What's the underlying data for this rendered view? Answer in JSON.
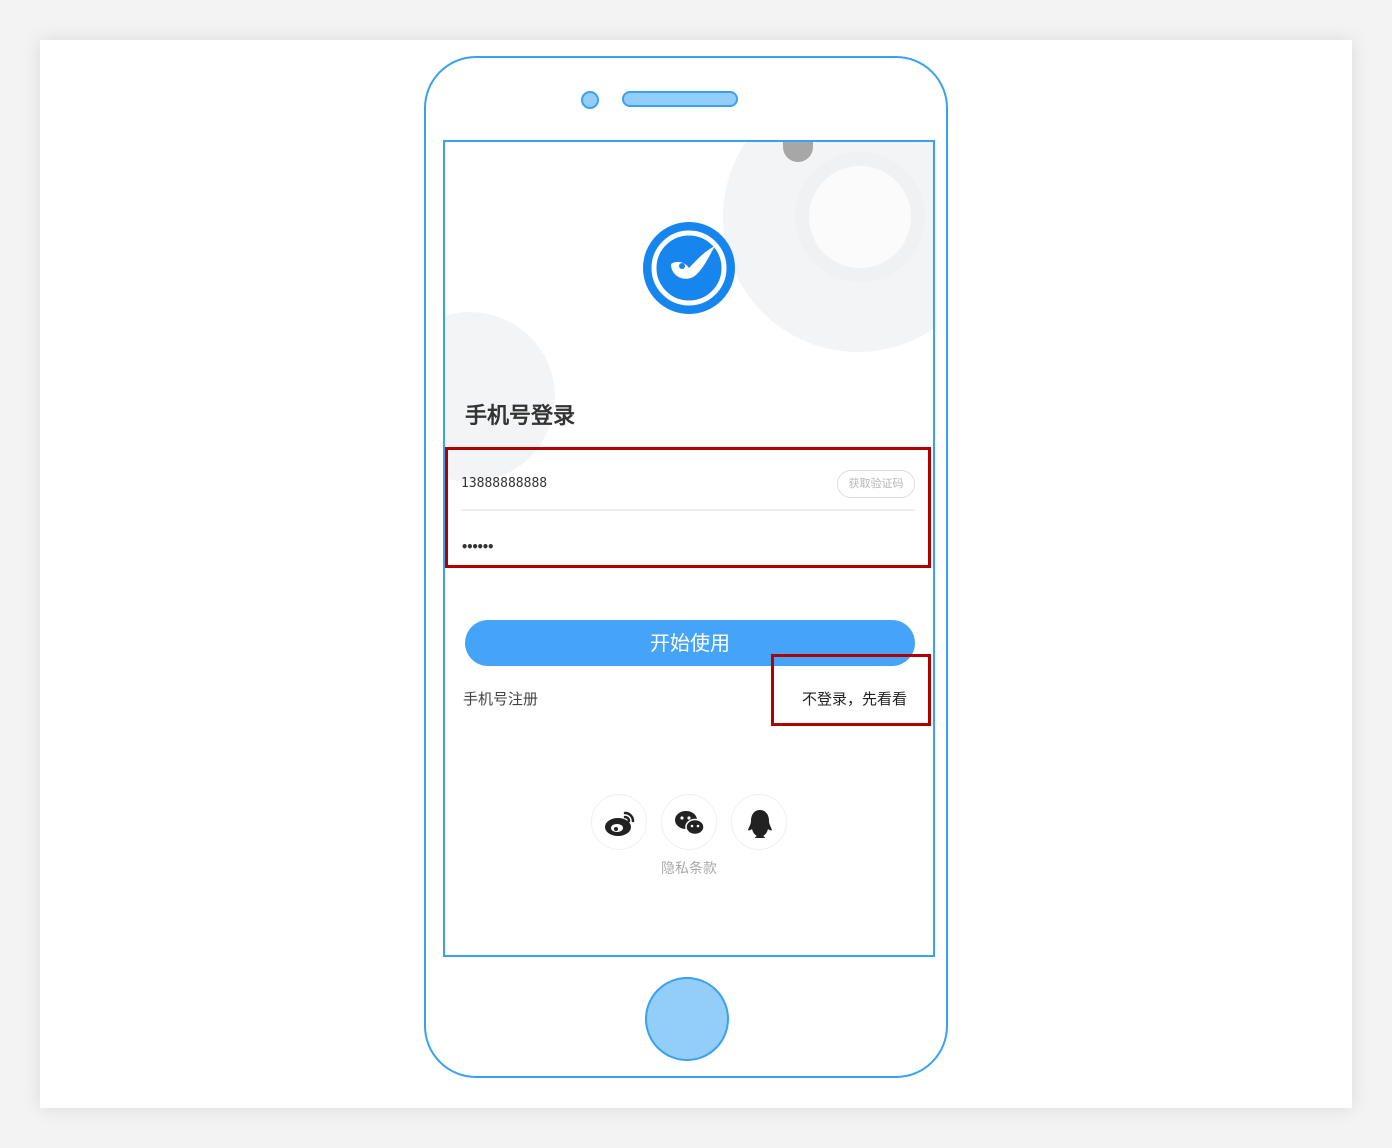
{
  "screen": {
    "title": "手机号登录",
    "phone_value": "13888888888",
    "password_value": "••••••",
    "get_code_label": "获取验证码",
    "start_button_label": "开始使用",
    "register_link_label": "手机号注册",
    "skip_login_label": "不登录，先看看",
    "social_logins": [
      "weibo-icon",
      "wechat-icon",
      "qq-icon"
    ],
    "privacy_link_label": "隐私条款"
  },
  "colors": {
    "device_outline": "#3aa0f0",
    "device_fill": "#93cef8",
    "primary_button": "#45a4f8",
    "logo": "#1686ee",
    "highlight_box": "#b00000"
  }
}
